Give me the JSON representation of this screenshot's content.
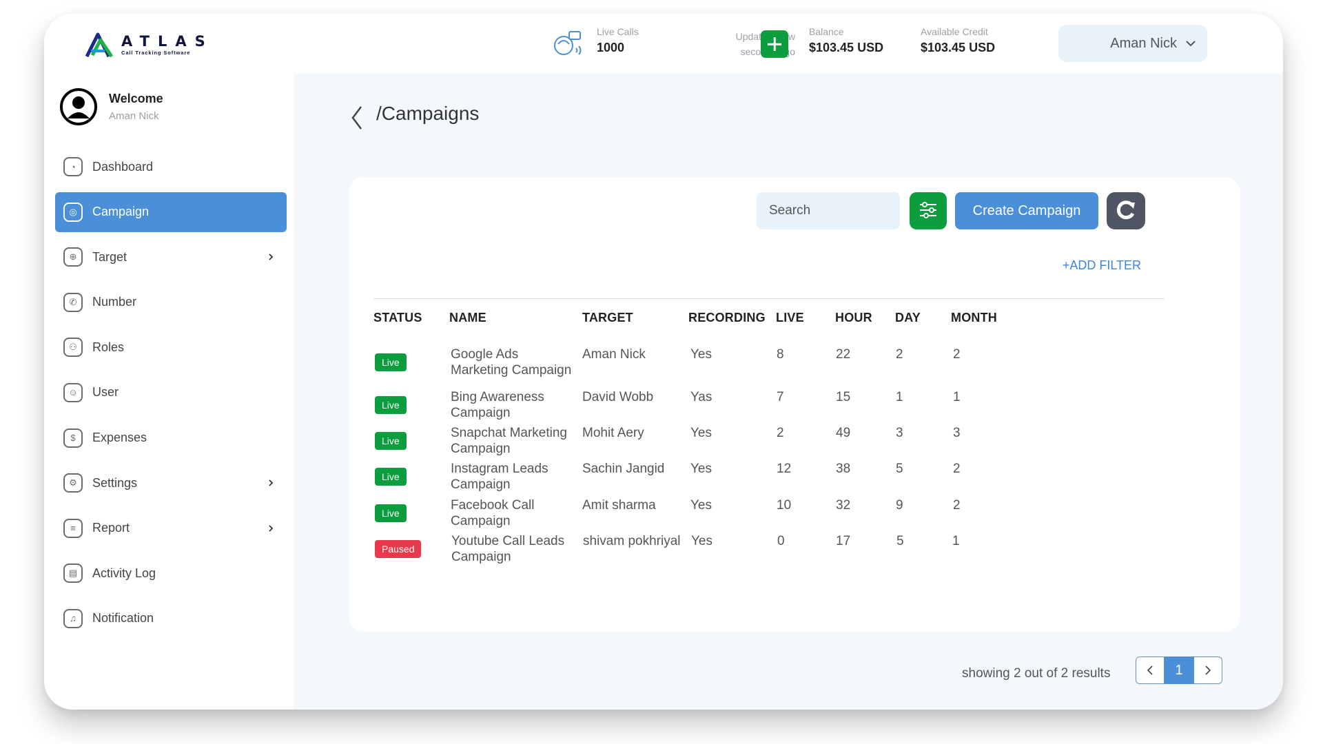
{
  "brand": {
    "name": "ATLAS",
    "tagline": "Call Tracking Software"
  },
  "header": {
    "live_calls": {
      "label": "Live Calls",
      "value": "1000"
    },
    "updated": {
      "line1": "Updateda few",
      "line2": "seconds ago"
    },
    "balance": {
      "label": "Balance",
      "value": "$103.45 USD"
    },
    "credit": {
      "label": "Available Credit",
      "value": "$103.45 USD"
    },
    "user_name": "Aman Nick"
  },
  "profile": {
    "welcome": "Welcome",
    "name": "Aman Nick"
  },
  "sidebar": {
    "items": [
      {
        "label": "Dashboard"
      },
      {
        "label": "Campaign"
      },
      {
        "label": "Target"
      },
      {
        "label": "Number"
      },
      {
        "label": "Roles"
      },
      {
        "label": "User"
      },
      {
        "label": "Expenses"
      },
      {
        "label": "Settings"
      },
      {
        "label": "Report"
      },
      {
        "label": "Activity Log"
      },
      {
        "label": "Notification"
      }
    ]
  },
  "main": {
    "title": "/Campaigns",
    "search_placeholder": "Search",
    "create_label": "Create Campaign",
    "add_filter": "+ADD FILTER",
    "columns": [
      "STATUS",
      "NAME",
      "TARGET",
      "RECORDING",
      "LIVE",
      "HOUR",
      "DAY",
      "MONTH"
    ],
    "rows": [
      {
        "status": "Live",
        "name1": "Google Ads",
        "name2": "Marketing Campaign",
        "target": "Aman Nick",
        "recording": "Yes",
        "live": "8",
        "hour": "22",
        "day": "2",
        "month": "2"
      },
      {
        "status": "Live",
        "name1": "Bing Awareness",
        "name2": "Campaign",
        "target": "David Wobb",
        "recording": "Yas",
        "live": "7",
        "hour": "15",
        "day": "1",
        "month": "1"
      },
      {
        "status": "Live",
        "name1": "Snapchat Marketing",
        "name2": "Campaign",
        "target": "Mohit Aery",
        "recording": "Yes",
        "live": "2",
        "hour": "49",
        "day": "3",
        "month": "3"
      },
      {
        "status": "Live",
        "name1": "Instagram Leads",
        "name2": "Campaign",
        "target": "Sachin Jangid",
        "recording": "Yes",
        "live": "12",
        "hour": "38",
        "day": "5",
        "month": "2"
      },
      {
        "status": "Live",
        "name1": "Facebook Call",
        "name2": "Campaign",
        "target": "Amit sharma",
        "recording": "Yes",
        "live": "10",
        "hour": "32",
        "day": "9",
        "month": "2"
      },
      {
        "status": "Paused",
        "name1": "Youtube Call Leads",
        "name2": "Campaign",
        "target": "shivam pokhriyal",
        "recording": "Yes",
        "live": "0",
        "hour": "17",
        "day": "5",
        "month": "1"
      }
    ],
    "results_text": "showing 2 out of 2 results",
    "current_page": "1"
  },
  "colors": {
    "accent": "#4a8fd8",
    "green": "#0b9d3e",
    "paused": "#e8394d",
    "bg": "#f4f8fc"
  }
}
